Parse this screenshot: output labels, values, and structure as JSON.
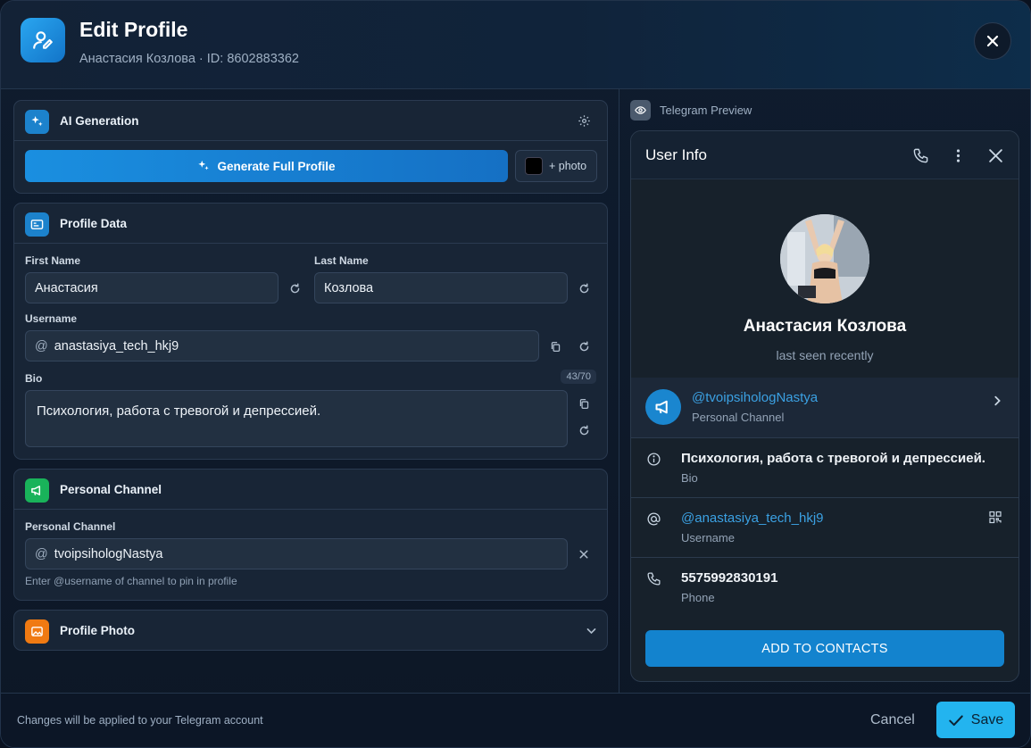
{
  "header": {
    "title": "Edit Profile",
    "subtitle": "Анастасия Козлова · ID: 8602883362"
  },
  "ai_generation": {
    "title": "AI Generation",
    "generate_label": "Generate Full Profile",
    "photo_label": "+ photo"
  },
  "profile_data": {
    "title": "Profile Data",
    "first_name_label": "First Name",
    "first_name_value": "Анастасия",
    "last_name_label": "Last Name",
    "last_name_value": "Козлова",
    "username_label": "Username",
    "username_prefix": "@",
    "username_value": "anastasiya_tech_hkj9",
    "bio_label": "Bio",
    "bio_counter": "43/70",
    "bio_value": "Психология, работа с тревогой и депрессией."
  },
  "personal_channel": {
    "title": "Personal Channel",
    "field_label": "Personal Channel",
    "prefix": "@",
    "value": "tvoipsihologNastya",
    "hint": "Enter @username of channel to pin in profile"
  },
  "profile_photo": {
    "title": "Profile Photo"
  },
  "footer": {
    "note": "Changes will be applied to your Telegram account",
    "cancel_label": "Cancel",
    "save_label": "Save"
  },
  "preview": {
    "tag": "Telegram Preview",
    "header_title": "User Info",
    "name": "Анастасия Козлова",
    "status": "last seen recently",
    "channel_handle": "@tvoipsihologNastya",
    "channel_sub": "Personal Channel",
    "bio_text": "Психология, работа с тревогой и депрессией.",
    "bio_sub": "Bio",
    "username_text": "@anastasiya_tech_hkj9",
    "username_sub": "Username",
    "phone_text": "5575992830191",
    "phone_sub": "Phone",
    "add_label": "ADD TO CONTACTS"
  },
  "colors": {
    "accent": "#1a8fe0",
    "save": "#23b4ef",
    "channel_icon": "#19b35a",
    "photo_icon": "#f07a12",
    "link": "#3ba1e3"
  }
}
